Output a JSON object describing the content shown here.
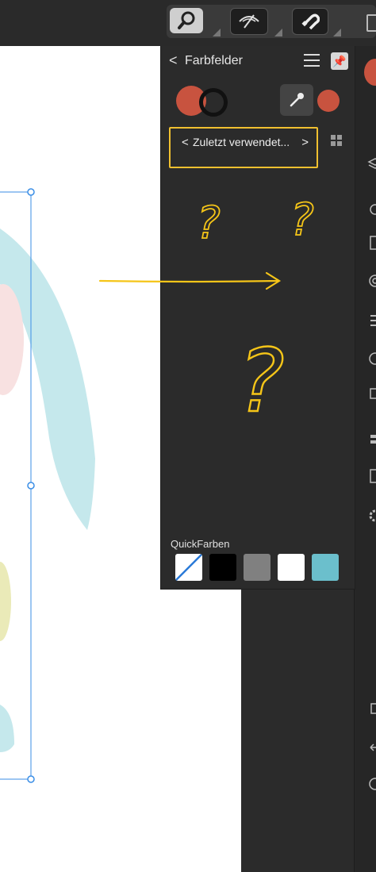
{
  "toolbar": {
    "buttons": [
      {
        "name": "zoom-tool",
        "icon": "magnifier-icon"
      },
      {
        "name": "view-mode",
        "icon": "eye-slash-icon"
      },
      {
        "name": "snapping",
        "icon": "magnet-icon"
      }
    ]
  },
  "panel": {
    "title": "Farbfelder",
    "back_icon": "<",
    "palette": {
      "label": "Zuletzt verwendet...",
      "prev": "<",
      "next": ">"
    },
    "fill_color": "#c8533f",
    "stroke_color": "#111111",
    "picker_color": "#c8533f",
    "quick_label": "QuickFarben",
    "quick_colors": [
      "none",
      "#000000",
      "#808080",
      "#ffffff",
      "#6bbfcc"
    ]
  },
  "annotations": {
    "marks": [
      "?",
      "?",
      "?"
    ],
    "color": "#f5c518"
  },
  "canvas": {
    "selection_color": "#3a8ee6"
  }
}
